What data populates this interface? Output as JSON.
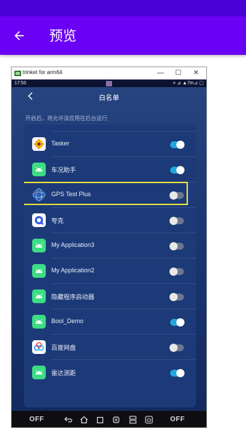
{
  "appbar": {
    "title": "预览"
  },
  "window": {
    "title": "trinket for arm64",
    "min": "—",
    "max": "☐",
    "close": "✕"
  },
  "emulator": {
    "time": "17:50",
    "status_right": "⋄ ⊿ ▲7m⊿ ▢",
    "nav_title": "白名单",
    "hint": "开启后，将允许该应用在后台运行",
    "apps": [
      {
        "name": "Tasker",
        "enabled": true,
        "icon": "tasker-icon"
      },
      {
        "name": "车况助手",
        "enabled": true,
        "icon": "android-icon"
      },
      {
        "name": "GPS Test Plus",
        "enabled": false,
        "icon": "gps-globe-icon"
      },
      {
        "name": "夸克",
        "enabled": false,
        "icon": "quark-icon"
      },
      {
        "name": "My Application3",
        "enabled": false,
        "icon": "android-icon"
      },
      {
        "name": "My Application2",
        "enabled": false,
        "icon": "android-icon"
      },
      {
        "name": "隐藏程序启动器",
        "enabled": false,
        "icon": "android-icon"
      },
      {
        "name": "Bool_Demo",
        "enabled": true,
        "icon": "android-icon"
      },
      {
        "name": "百度网盘",
        "enabled": false,
        "icon": "baidu-netdisk-icon"
      },
      {
        "name": "雷达测距",
        "enabled": true,
        "icon": "android-icon"
      }
    ],
    "bottom": {
      "left_label": "OFF",
      "right_label": "OFF"
    }
  },
  "colors": {
    "appbar": "#6a00f4",
    "statusbar": "#4b00d6",
    "toggle_on": "#1fa8e0",
    "highlight": "#e8e03a"
  }
}
